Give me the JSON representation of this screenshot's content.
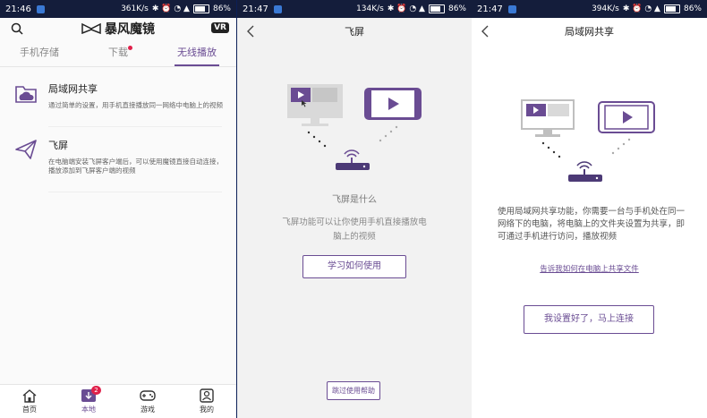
{
  "colors": {
    "accent": "#6a4c93",
    "badge": "#e0204a",
    "statusbar": "#141d3b"
  },
  "panel1": {
    "status": {
      "time": "21:46",
      "speed": "361K/s",
      "battery": "86%"
    },
    "brand": "暴风魔镜",
    "vr_badge": "VR",
    "tabs": [
      {
        "label": "手机存储"
      },
      {
        "label": "下载"
      },
      {
        "label": "无线播放"
      }
    ],
    "items": [
      {
        "title": "局域网共享",
        "desc": "通过简单的设置，用手机直接播放同一网络中电脑上的视频",
        "icon": "folder-cloud-icon"
      },
      {
        "title": "飞屏",
        "desc": "在电脑端安装飞屏客户端后，可以使用魔镜直接自动连接，播放添加到飞屏客户端的视频",
        "icon": "paper-plane-icon"
      }
    ],
    "nav": [
      {
        "label": "首页",
        "icon": "home-icon"
      },
      {
        "label": "本地",
        "icon": "download-icon",
        "badge": "2"
      },
      {
        "label": "游戏",
        "icon": "gamepad-icon"
      },
      {
        "label": "我的",
        "icon": "user-icon"
      }
    ]
  },
  "panel2": {
    "status": {
      "time": "21:47",
      "speed": "134K/s",
      "battery": "86%"
    },
    "title": "飞屏",
    "question": "飞屏是什么",
    "desc": "飞屏功能可以让你使用手机直接播放电脑上的视频",
    "learn_button": "学习如何使用",
    "skip_button": "跳过使用帮助"
  },
  "panel3": {
    "status": {
      "time": "21:47",
      "speed": "394K/s",
      "battery": "86%"
    },
    "title": "局域网共享",
    "desc": "使用局域网共享功能，你需要一台与手机处在同一网络下的电脑，将电脑上的文件夹设置为共享，即可通过手机进行访问，播放视频",
    "link": "告诉我如何在电脑上共享文件",
    "connect_button": "我设置好了，马上连接"
  }
}
